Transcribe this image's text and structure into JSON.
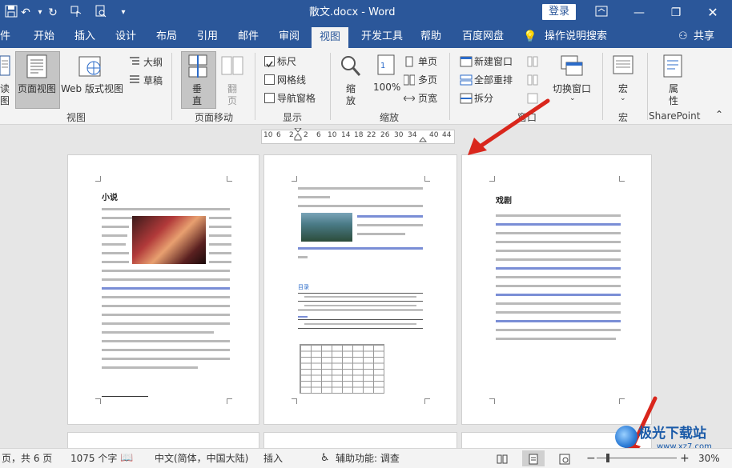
{
  "titlebar": {
    "title": "散文.docx  -  Word",
    "login": "登录",
    "icons": [
      "save-icon",
      "undo-icon",
      "redo-icon",
      "touch-mode-icon",
      "print-preview-icon",
      "customize-qat-icon"
    ]
  },
  "tabs": [
    "件",
    "开始",
    "插入",
    "设计",
    "布局",
    "引用",
    "邮件",
    "审阅",
    "视图",
    "开发工具",
    "帮助",
    "百度网盘",
    "操作说明搜索",
    "共享"
  ],
  "ribbon": {
    "read_label": [
      "读",
      "图"
    ],
    "print_layout": "页面视图",
    "web_layout": "Web 版式视图",
    "outline": "大纲",
    "draft": "草稿",
    "vertical": [
      "垂",
      "直"
    ],
    "side_to_side": [
      "翻",
      "页"
    ],
    "ruler": "标尺",
    "gridlines": "网格线",
    "nav_pane": "导航窗格",
    "zoom": [
      "缩",
      "放"
    ],
    "zoom100": "100%",
    "one_page": "单页",
    "multi_page": "多页",
    "page_width": "页宽",
    "new_window": "新建窗口",
    "arrange_all": "全部重排",
    "split": "拆分",
    "switch_window": "切换窗口",
    "macros": "宏",
    "properties": [
      "属",
      "性"
    ],
    "groups": {
      "view": "视图",
      "page_move": "页面移动",
      "show": "显示",
      "zoom": "缩放",
      "window": "窗口",
      "macro": "宏",
      "sharepoint": "SharePoint"
    }
  },
  "ruler_numbers": [
    "10",
    "6",
    "2",
    "2",
    "6",
    "10",
    "14",
    "18",
    "22",
    "26",
    "30",
    "34",
    "",
    "40",
    "44"
  ],
  "pages": {
    "p1_title": "小说",
    "p3_title": "戏剧",
    "p2_heading": "目录"
  },
  "status": {
    "page": "页，共 6 页",
    "words": "1075 个字",
    "lang": "中文(简体，中国大陆)",
    "insert": "插入",
    "accessibility": "辅助功能: 调查",
    "zoom": "30%"
  },
  "watermark": {
    "text": "极光下载站",
    "url": "www.xz7.com"
  },
  "colors": {
    "brand": "#2b579a",
    "arrow": "#d9261c"
  }
}
